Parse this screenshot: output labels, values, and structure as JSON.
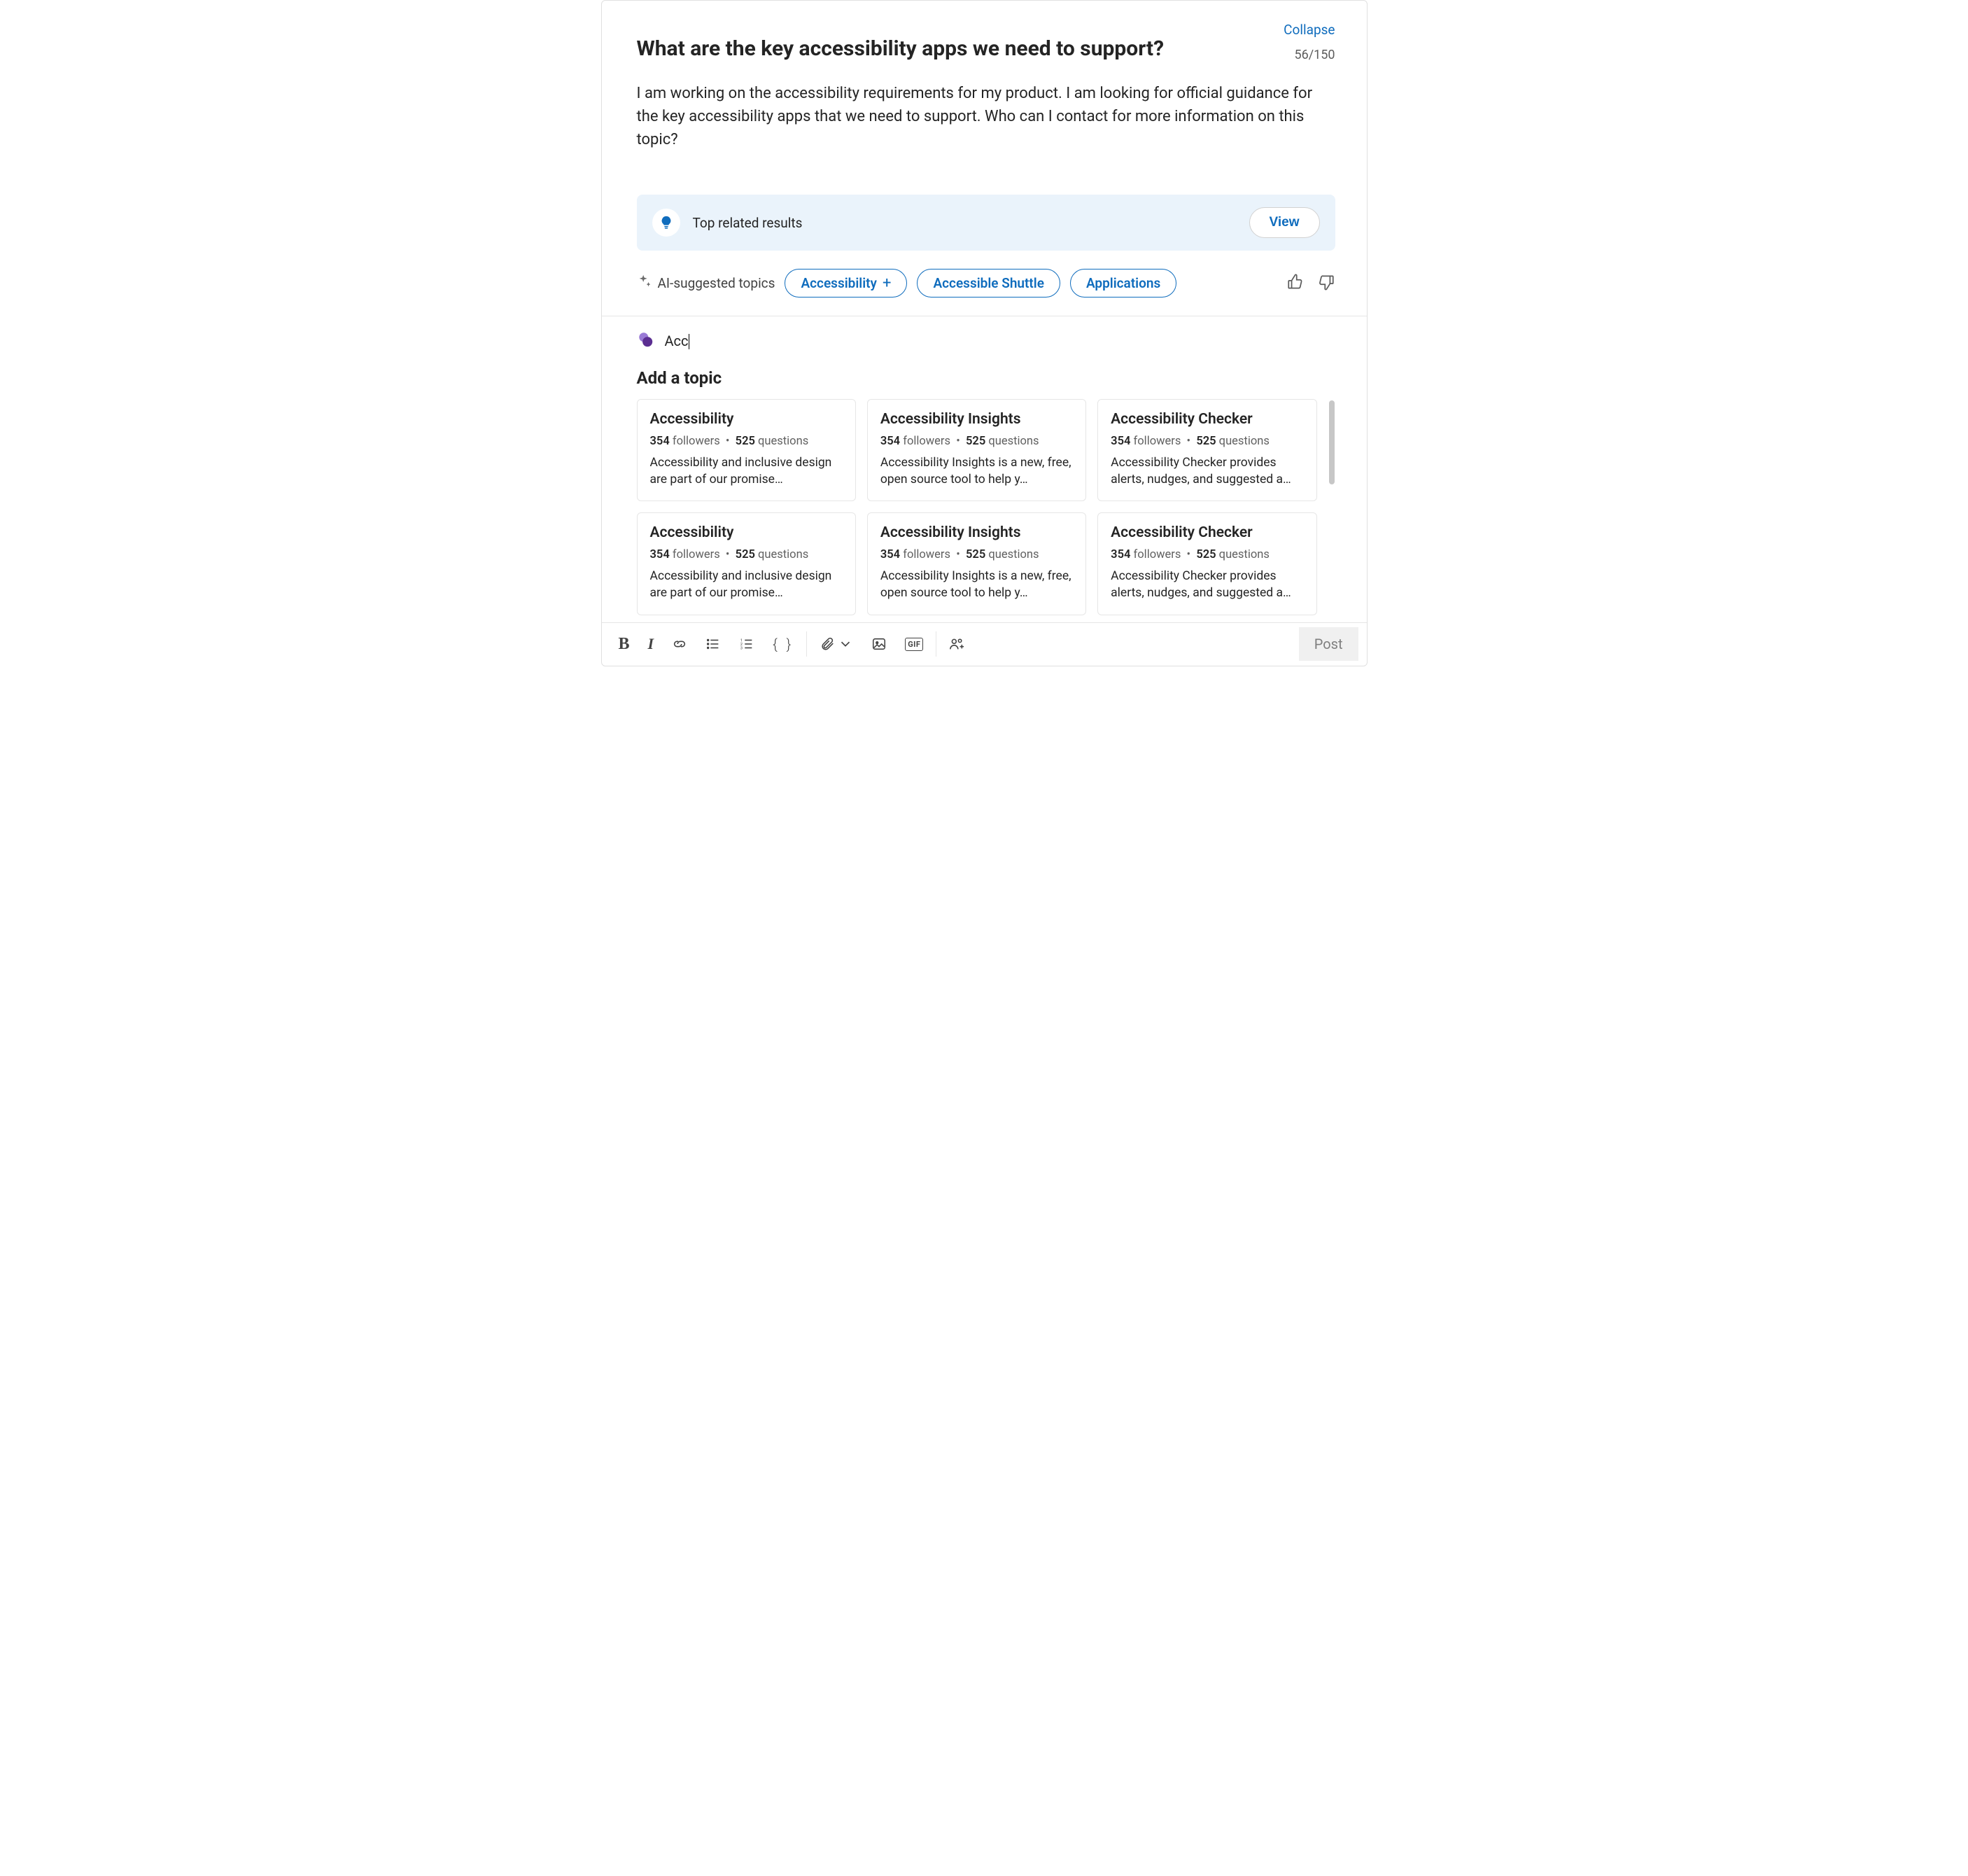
{
  "collapse_label": "Collapse",
  "char_counter": "56/150",
  "title": "What are the key accessibility apps we need to support?",
  "body": "I am working on the accessibility requirements for my product. I am looking for official guidance for the key accessibility apps that we need to support. Who can I contact for more information on this topic?",
  "related": {
    "label": "Top related results",
    "view_label": "View"
  },
  "ai": {
    "label": "AI-suggested topics",
    "chips": [
      {
        "label": "Accessibility",
        "has_plus": true
      },
      {
        "label": "Accessible Shuttle",
        "has_plus": false
      },
      {
        "label": "Applications",
        "has_plus": false
      }
    ]
  },
  "hashtag_input": "Acc",
  "add_topic_heading": "Add a topic",
  "meta_labels": {
    "followers": "followers",
    "questions": "questions",
    "dot": "•"
  },
  "cards": [
    {
      "title": "Accessibility",
      "followers": "354",
      "questions": "525",
      "desc": "Accessibility and inclusive design are part of our promise…"
    },
    {
      "title": "Accessibility Insights",
      "followers": "354",
      "questions": "525",
      "desc": "Accessibility Insights is a new, free, open source tool to help y…"
    },
    {
      "title": "Accessibility Checker",
      "followers": "354",
      "questions": "525",
      "desc": "Accessibility Checker provides alerts, nudges, and suggested a…"
    },
    {
      "title": "Accessibility",
      "followers": "354",
      "questions": "525",
      "desc": "Accessibility and inclusive design are part of our promise…"
    },
    {
      "title": "Accessibility Insights",
      "followers": "354",
      "questions": "525",
      "desc": "Accessibility Insights is a new, free, open source tool to help y…"
    },
    {
      "title": "Accessibility Checker",
      "followers": "354",
      "questions": "525",
      "desc": "Accessibility Checker provides alerts, nudges, and suggested a…"
    }
  ],
  "toolbar": {
    "gif_label": "GIF",
    "post_label": "Post"
  }
}
